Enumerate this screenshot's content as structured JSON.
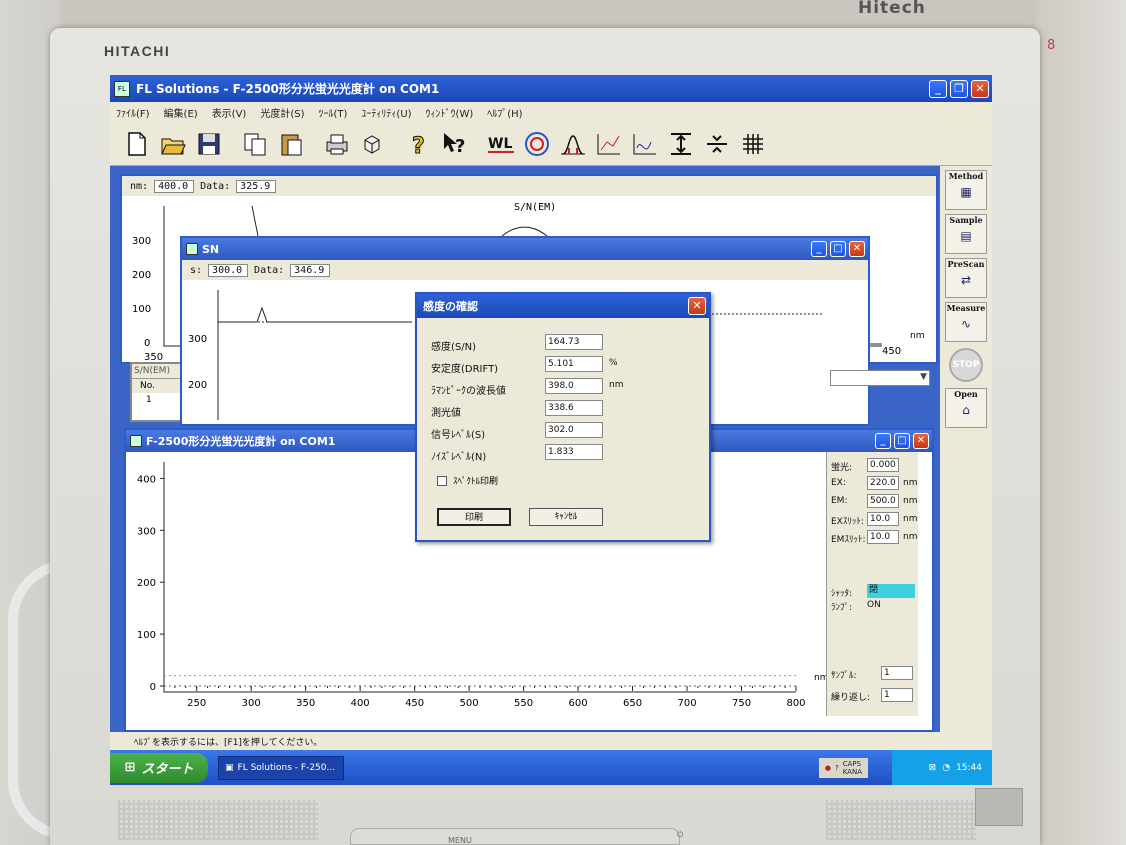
{
  "environment": {
    "brand": "HITACHI",
    "wall_label": "Hitech",
    "wall_number": "8",
    "bezel_menu": "MENU",
    "bezel_power": "⏻"
  },
  "window": {
    "title": "FL Solutions - F-2500形分光蛍光光度計 on COM1",
    "menu": [
      "ﾌｧｲﾙ(F)",
      "編集(E)",
      "表示(V)",
      "光度計(S)",
      "ﾂｰﾙ(T)",
      "ﾕｰﾃｨﾘﾃｨ(U)",
      "ｳｨﾝﾄﾞｳ(W)",
      "ﾍﾙﾌﾟ(H)"
    ],
    "toolbar_wl": "WL"
  },
  "side_buttons": [
    {
      "label": "Method",
      "icon": "method-icon"
    },
    {
      "label": "Sample",
      "icon": "sample-icon"
    },
    {
      "label": "PreScan",
      "icon": "prescan-icon"
    },
    {
      "label": "Measure",
      "icon": "measure-icon"
    }
  ],
  "stop_label": "STOP",
  "open_label": "Open",
  "sn_em_window": {
    "readout_nm_label": "nm:",
    "readout_nm": "400.0",
    "readout_data_label": "Data:",
    "readout_data": "325.9",
    "graph_title": "S/N(EM)",
    "yticks": [
      "300",
      "200",
      "100",
      "0"
    ],
    "xtick_left": "350",
    "xtick_right": "450",
    "unit": "nm"
  },
  "sn_list": {
    "header": "S/N(EM)",
    "col": "No.",
    "row1": "1"
  },
  "sn_window": {
    "title": "SN",
    "readout_s_label": "s:",
    "readout_s": "300.0",
    "readout_data_label": "Data:",
    "readout_data": "346.9",
    "yticks": [
      "300",
      "200"
    ]
  },
  "main_graph_window": {
    "title": "F-2500形分光蛍光光度計 on COM1",
    "chart_data": {
      "type": "line",
      "x": [
        200,
        800
      ],
      "y": [
        0,
        0
      ],
      "xlim": [
        220,
        800
      ],
      "ylim": [
        0,
        420
      ],
      "xticks": [
        "250",
        "300",
        "350",
        "400",
        "450",
        "500",
        "550",
        "600",
        "650",
        "700",
        "750",
        "800"
      ],
      "yticks": [
        "400",
        "300",
        "200",
        "100",
        "0"
      ],
      "xlabel": "nm"
    },
    "info": {
      "fl_label": "蛍光:",
      "fl_value": "0.000",
      "ex_label": "EX:",
      "ex_value": "220.0",
      "ex_unit": "nm",
      "em_label": "EM:",
      "em_value": "500.0",
      "em_unit": "nm",
      "exslit_label": "EXｽﾘｯﾄ:",
      "exslit_value": "10.0",
      "exslit_unit": "nm",
      "emslit_label": "EMｽﾘｯﾄ:",
      "emslit_value": "10.0",
      "emslit_unit": "nm",
      "shutter_label": "ｼｬｯﾀ:",
      "shutter_value": "閉",
      "lamp_label": "ﾗﾝﾌﾟ:",
      "lamp_value": "ON",
      "sample_label": "ｻﾝﾌﾟﾙ:",
      "sample_value": "1",
      "repeat_label": "繰り返し:",
      "repeat_value": "1"
    }
  },
  "dialog": {
    "title": "感度の確認",
    "rows": [
      {
        "label": "感度(S/N)",
        "value": "164.73",
        "unit": ""
      },
      {
        "label": "安定度(DRIFT)",
        "value": "5.101",
        "unit": "%"
      },
      {
        "label": "ﾗﾏﾝﾋﾟｰｸの波長値",
        "value": "398.0",
        "unit": "nm"
      },
      {
        "label": "測光値",
        "value": "338.6",
        "unit": ""
      },
      {
        "label": "信号ﾚﾍﾞﾙ(S)",
        "value": "302.0",
        "unit": ""
      },
      {
        "label": "ﾉｲｽﾞﾚﾍﾞﾙ(N)",
        "value": "1.833",
        "unit": ""
      }
    ],
    "checkbox_label": "ｽﾍﾟｸﾄﾙ印刷",
    "print_button": "印刷",
    "cancel_button": "ｷｬﾝｾﾙ"
  },
  "statusbar": "ﾍﾙﾌﾟを表示するには、[F1]を押してください。",
  "taskbar": {
    "start": "スタート",
    "task": "FL Solutions - F-250...",
    "time": "15:44",
    "ime_top": "CAPS",
    "ime_bottom": "KANA"
  },
  "colors": {
    "title_blue": "#1a48b8",
    "shutter_highlight": "#3fd0e0",
    "start_green": "#2e8a2e"
  }
}
